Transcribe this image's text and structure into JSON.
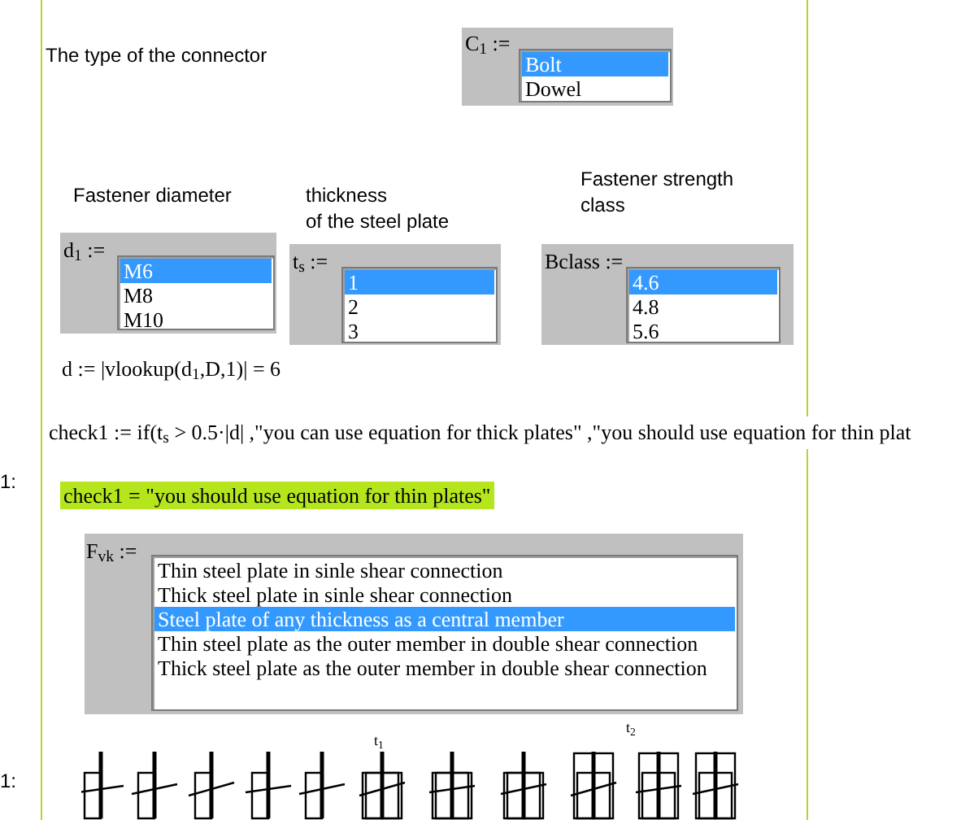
{
  "connector": {
    "label": "The type of the connector",
    "variable": "C$_{1}$ :=",
    "items": [
      {
        "text": "Bolt",
        "selected": true
      },
      {
        "text": "Dowel",
        "selected": false
      }
    ]
  },
  "selectors": [
    {
      "label_lines": [
        "Fastener diameter"
      ],
      "variable": "d$_{1}$ :=",
      "items": [
        {
          "text": "M6",
          "selected": true
        },
        {
          "text": "M8",
          "selected": false
        },
        {
          "text": "M10",
          "selected": false
        }
      ]
    },
    {
      "label_lines": [
        "thickness",
        "of the steel plate"
      ],
      "variable": "t$_{s}$ :=",
      "items": [
        {
          "text": "1",
          "selected": true
        },
        {
          "text": "2",
          "selected": false
        },
        {
          "text": "3",
          "selected": false
        }
      ]
    },
    {
      "label_lines": [
        "Fastener strength",
        "class"
      ],
      "variable": "Bclass :=",
      "items": [
        {
          "text": "4.6",
          "selected": true
        },
        {
          "text": "4.8",
          "selected": false
        },
        {
          "text": "5.6",
          "selected": false
        }
      ]
    }
  ],
  "d_formula": "d := |vlookup(d$_{1}$,D,1)| = 6",
  "check_formula": "check1 := if(t$_{s}$ > 0.5·|d| ,\"you can use equation for thick plates\" ,\"you should use equation for thin plat",
  "margin_labels": [
    "1:",
    "1:"
  ],
  "check_result": "check1 = \"you should use equation for thin plates\"",
  "fvk": {
    "variable": "F$_{vk}$ :=",
    "items": [
      {
        "text": "Thin steel plate in sinle shear connection",
        "selected": false
      },
      {
        "text": "Thick steel plate in sinle shear connection",
        "selected": false
      },
      {
        "text": "Steel plate of any thickness as a central member",
        "selected": true
      },
      {
        "text": "Thin steel plate as the outer member in double shear connection",
        "selected": false
      },
      {
        "text": "Thick steel plate as the outer member in double shear connection",
        "selected": false
      }
    ]
  },
  "figure_labels": [
    "t$_{1}$",
    "t$_{2}$"
  ]
}
